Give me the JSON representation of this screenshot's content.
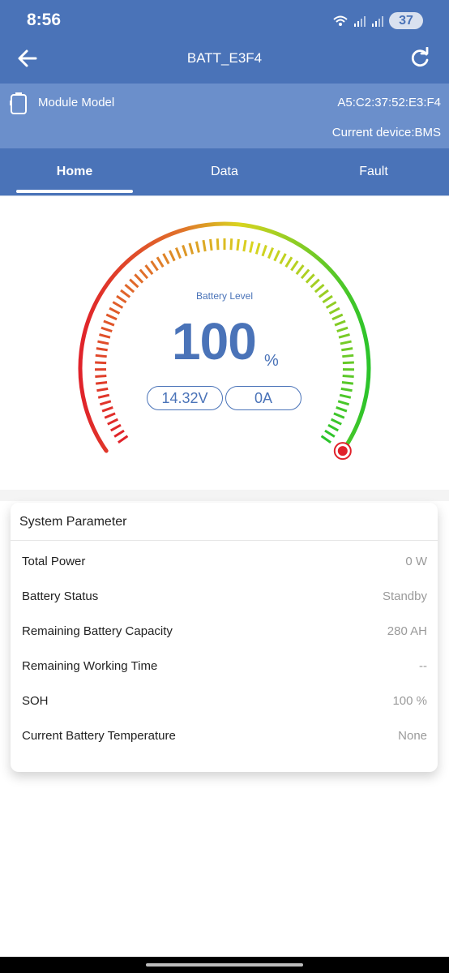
{
  "status_bar": {
    "time": "8:56",
    "battery": "37"
  },
  "app_bar": {
    "title": "BATT_E3F4"
  },
  "module": {
    "label": "Module Model",
    "mac": "A5:C2:37:52:E3:F4",
    "current_device": "Current device:BMS"
  },
  "tabs": [
    {
      "label": "Home",
      "active": true
    },
    {
      "label": "Data",
      "active": false
    },
    {
      "label": "Fault",
      "active": false
    }
  ],
  "gauge": {
    "label": "Battery Level",
    "value": "100",
    "unit": "%",
    "level_fraction": 1.0,
    "voltage": "14.32V",
    "current": "0A"
  },
  "system_parameter": {
    "title": "System Parameter",
    "rows": [
      {
        "label": "Total Power",
        "value": "0 W"
      },
      {
        "label": "Battery Status",
        "value": "Standby"
      },
      {
        "label": "Remaining Battery Capacity",
        "value": "280 AH"
      },
      {
        "label": "Remaining Working Time",
        "value": "--"
      },
      {
        "label": "SOH",
        "value": "100 %"
      },
      {
        "label": "Current Battery Temperature",
        "value": "None"
      }
    ]
  },
  "colors": {
    "primary": "#4a73b8",
    "panel": "#6b8fcb",
    "gauge_red": "#e0222a",
    "gauge_yellow": "#d9d41f",
    "gauge_green": "#2bc42b"
  }
}
